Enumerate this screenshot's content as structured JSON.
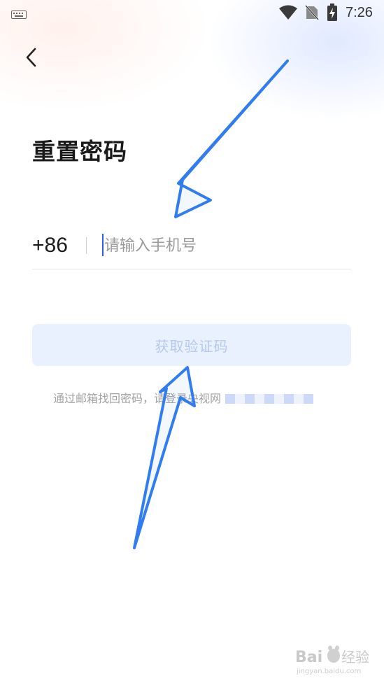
{
  "status_bar": {
    "time": "7:26",
    "icons": [
      "keyboard-icon",
      "wifi-icon",
      "no-sim-icon",
      "battery-charging-icon"
    ]
  },
  "header": {
    "back_icon": "chevron-left-icon",
    "title": "重置密码"
  },
  "phone_form": {
    "country_code": "+86",
    "input_value": "",
    "input_placeholder": "请输入手机号"
  },
  "get_code_button": {
    "label": "获取验证码"
  },
  "email_recovery": {
    "hint": "通过邮箱找回密码，请登录央视网"
  },
  "overlay": {
    "arrow_color": "#2f7df0",
    "watermark_text": "Baidu经验",
    "watermark_subtext": "jingyan.baidu.com"
  },
  "colors": {
    "accent": "#2f5fe0",
    "button_bg": "#eaf1fe",
    "button_text": "#b6c8ef"
  }
}
